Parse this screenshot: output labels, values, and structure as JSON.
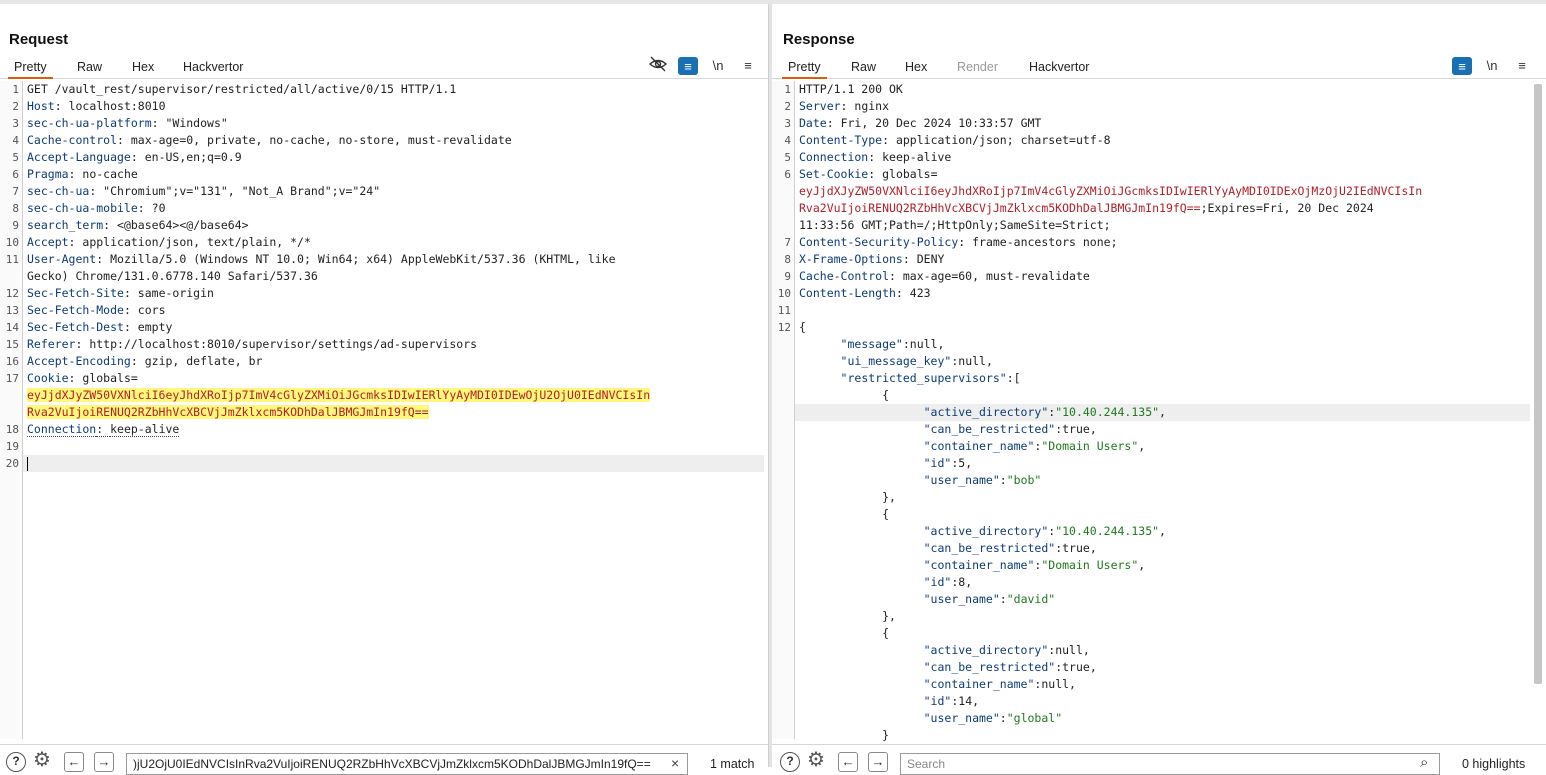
{
  "layout_buttons": [
    "▮▮",
    "☰",
    "▬"
  ],
  "request": {
    "title": "Request",
    "tabs": [
      "Pretty",
      "Raw",
      "Hex",
      "Hackvertor"
    ],
    "tools": {
      "hide": "👁",
      "wrap": "≡",
      "newline": "\\n",
      "menu": "≡"
    },
    "line_numbers": [
      "1",
      "2",
      "3",
      "4",
      "5",
      "6",
      "7",
      "8",
      "9",
      "10",
      "11",
      "",
      "12",
      "13",
      "14",
      "15",
      "16",
      "17",
      "",
      "",
      "18",
      "19",
      "20"
    ],
    "lines": [
      {
        "k": "GET /vault_rest/supervisor/restricted/all/active/0/15 HTTP/1.1",
        "v": ""
      },
      {
        "k": "Host",
        "v": "localhost:8010"
      },
      {
        "k": "sec-ch-ua-platform",
        "v": "\"Windows\""
      },
      {
        "k": "Cache-control",
        "v": "max-age=0, private, no-cache, no-store, must-revalidate"
      },
      {
        "k": "Accept-Language",
        "v": "en-US,en;q=0.9"
      },
      {
        "k": "Pragma",
        "v": "no-cache"
      },
      {
        "k": "sec-ch-ua",
        "v": "\"Chromium\";v=\"131\", \"Not_A Brand\";v=\"24\""
      },
      {
        "k": "sec-ch-ua-mobile",
        "v": "?0"
      },
      {
        "k": "search_term",
        "v": "<@base64><@/base64>"
      },
      {
        "k": "Accept",
        "v": "application/json, text/plain, */*"
      },
      {
        "k": "User-Agent",
        "v": "Mozilla/5.0 (Windows NT 10.0; Win64; x64) AppleWebKit/537.36 (KHTML, like"
      },
      {
        "k": "",
        "v": "Gecko) Chrome/131.0.6778.140 Safari/537.36"
      },
      {
        "k": "Sec-Fetch-Site",
        "v": "same-origin"
      },
      {
        "k": "Sec-Fetch-Mode",
        "v": "cors"
      },
      {
        "k": "Sec-Fetch-Dest",
        "v": "empty"
      },
      {
        "k": "Referer",
        "v": "http://localhost:8010/supervisor/settings/ad-supervisors"
      },
      {
        "k": "Accept-Encoding",
        "v": "gzip, deflate, br"
      },
      {
        "k": "Cookie",
        "v": "globals="
      },
      {
        "k": "",
        "v": "eyJjdXJyZW50VXNlciI6eyJhdXRoIjp7ImV4cGlyZXMiOiJGcmksIDIwIERlYyAyMDI0IDEwOjU2OjU0IEdNVCIsIn"
      },
      {
        "k": "",
        "v": "Rva2VuIjoiRENUQ2RZbHhVcXBCVjJmZklxcm5KODhDalJBMGJmIn19fQ=="
      },
      {
        "k": "Connection",
        "v": "keep-alive"
      },
      {
        "k": "",
        "v": ""
      },
      {
        "k": "",
        "v": ""
      }
    ],
    "search_value": ")jU2OjU0IEdNVCIsInRva2VuIjoiRENUQ2RZbHhVcXBCVjJmZklxcm5KODhDalJBMGJmIn19fQ==",
    "search_clear": "×",
    "match_text": "1 match",
    "help": "?",
    "settings": "⚙",
    "prev": "←",
    "next": "→"
  },
  "response": {
    "title": "Response",
    "tabs": [
      "Pretty",
      "Raw",
      "Hex",
      "Render",
      "Hackvertor"
    ],
    "tools": {
      "wrap": "≡",
      "newline": "\\n",
      "menu": "≡"
    },
    "line_numbers": [
      "1",
      "2",
      "3",
      "4",
      "5",
      "6",
      "",
      "",
      "",
      "7",
      "8",
      "9",
      "10",
      "11",
      "12",
      "",
      "",
      "",
      "",
      "",
      "",
      "",
      "",
      "",
      "",
      "",
      "",
      "",
      "",
      "",
      "",
      "",
      "",
      "",
      ""
    ],
    "lines": [
      {
        "k": "HTTP/1.1 200 OK",
        "v": ""
      },
      {
        "k": "Server",
        "v": "nginx"
      },
      {
        "k": "Date",
        "v": "Fri, 20 Dec 2024 10:33:57 GMT"
      },
      {
        "k": "Content-Type",
        "v": "application/json; charset=utf-8"
      },
      {
        "k": "Connection",
        "v": "keep-alive"
      },
      {
        "k": "Set-Cookie",
        "v": "globals="
      },
      {
        "k": "",
        "v": "eyJjdXJyZW50VXNlciI6eyJhdXRoIjp7ImV4cGlyZXMiOiJGcmksIDIwIERlYyAyMDI0IDExOjMzOjU2IEdNVCIsIn"
      },
      {
        "k": "",
        "v": "Rva2VuIjoiRENUQ2RZbHhVcXBCVjJmZklxcm5KODhDalJBMGJmIn19fQ==;Expires=Fri, 20 Dec 2024"
      },
      {
        "k": "",
        "v": "11:33:56 GMT;Path=/;HttpOnly;SameSite=Strict;"
      },
      {
        "k": "Content-Security-Policy",
        "v": "frame-ancestors none;"
      },
      {
        "k": "X-Frame-Options",
        "v": "DENY"
      },
      {
        "k": "Cache-Control",
        "v": "max-age=60, must-revalidate"
      },
      {
        "k": "Content-Length",
        "v": "423"
      },
      {
        "k": "",
        "v": ""
      },
      {
        "k": "",
        "v": "{"
      }
    ],
    "json_lines": [
      {
        "indent": 1,
        "key": "\"message\"",
        "sep": ":",
        "val": "null",
        "vt": "n",
        "tail": ","
      },
      {
        "indent": 1,
        "key": "\"ui_message_key\"",
        "sep": ":",
        "val": "null",
        "vt": "n",
        "tail": ","
      },
      {
        "indent": 1,
        "key": "\"restricted_supervisors\"",
        "sep": ":",
        "val": "[",
        "vt": "p",
        "tail": ""
      },
      {
        "indent": 2,
        "key": "",
        "sep": "",
        "val": "{",
        "vt": "p",
        "tail": ""
      },
      {
        "indent": 3,
        "key": "\"active_directory\"",
        "sep": ":",
        "val": "\"10.40.244.135\"",
        "vt": "s",
        "tail": ","
      },
      {
        "indent": 3,
        "key": "\"can_be_restricted\"",
        "sep": ":",
        "val": "true",
        "vt": "n",
        "tail": ","
      },
      {
        "indent": 3,
        "key": "\"container_name\"",
        "sep": ":",
        "val": "\"Domain Users\"",
        "vt": "s",
        "tail": ","
      },
      {
        "indent": 3,
        "key": "\"id\"",
        "sep": ":",
        "val": "5",
        "vt": "n",
        "tail": ","
      },
      {
        "indent": 3,
        "key": "\"user_name\"",
        "sep": ":",
        "val": "\"bob\"",
        "vt": "s",
        "tail": ""
      },
      {
        "indent": 2,
        "key": "",
        "sep": "",
        "val": "},",
        "vt": "p",
        "tail": ""
      },
      {
        "indent": 2,
        "key": "",
        "sep": "",
        "val": "{",
        "vt": "p",
        "tail": ""
      },
      {
        "indent": 3,
        "key": "\"active_directory\"",
        "sep": ":",
        "val": "\"10.40.244.135\"",
        "vt": "s",
        "tail": ","
      },
      {
        "indent": 3,
        "key": "\"can_be_restricted\"",
        "sep": ":",
        "val": "true",
        "vt": "n",
        "tail": ","
      },
      {
        "indent": 3,
        "key": "\"container_name\"",
        "sep": ":",
        "val": "\"Domain Users\"",
        "vt": "s",
        "tail": ","
      },
      {
        "indent": 3,
        "key": "\"id\"",
        "sep": ":",
        "val": "8",
        "vt": "n",
        "tail": ","
      },
      {
        "indent": 3,
        "key": "\"user_name\"",
        "sep": ":",
        "val": "\"david\"",
        "vt": "s",
        "tail": ""
      },
      {
        "indent": 2,
        "key": "",
        "sep": "",
        "val": "},",
        "vt": "p",
        "tail": ""
      },
      {
        "indent": 2,
        "key": "",
        "sep": "",
        "val": "{",
        "vt": "p",
        "tail": ""
      },
      {
        "indent": 3,
        "key": "\"active_directory\"",
        "sep": ":",
        "val": "null",
        "vt": "n",
        "tail": ","
      },
      {
        "indent": 3,
        "key": "\"can_be_restricted\"",
        "sep": ":",
        "val": "true",
        "vt": "n",
        "tail": ","
      },
      {
        "indent": 3,
        "key": "\"container_name\"",
        "sep": ":",
        "val": "null",
        "vt": "n",
        "tail": ","
      },
      {
        "indent": 3,
        "key": "\"id\"",
        "sep": ":",
        "val": "14",
        "vt": "n",
        "tail": ","
      },
      {
        "indent": 3,
        "key": "\"user_name\"",
        "sep": ":",
        "val": "\"global\"",
        "vt": "s",
        "tail": ""
      },
      {
        "indent": 2,
        "key": "",
        "sep": "",
        "val": "}",
        "vt": "p",
        "tail": ""
      }
    ],
    "search_placeholder": "Search",
    "search_icon": "⌕",
    "match_text": "0 highlights",
    "help": "?",
    "settings": "⚙",
    "prev": "←",
    "next": "→"
  }
}
